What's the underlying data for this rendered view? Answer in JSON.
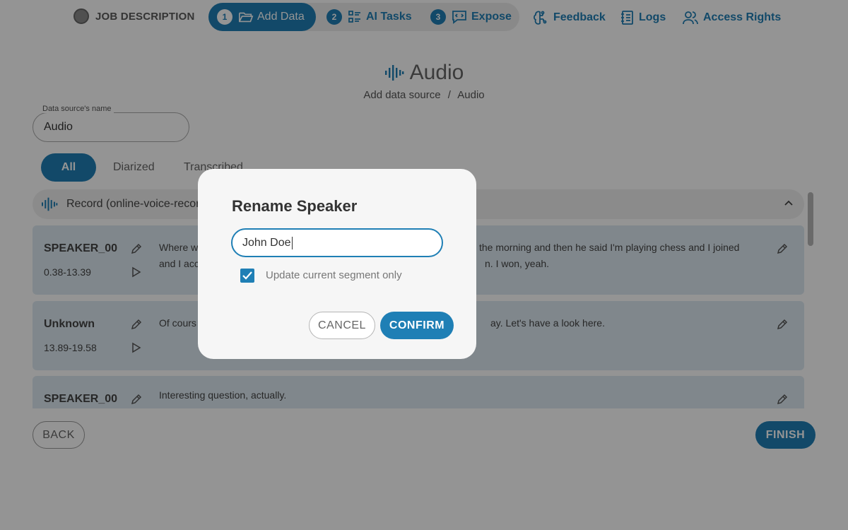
{
  "nav": {
    "job_label": "JOB DESCRIPTION",
    "steps": [
      {
        "num": "1",
        "label": "Add Data",
        "icon": "folder-open-icon"
      },
      {
        "num": "2",
        "label": "AI Tasks",
        "icon": "task-list-icon"
      },
      {
        "num": "3",
        "label": "Expose",
        "icon": "code-bubble-icon"
      }
    ],
    "links": [
      {
        "label": "Feedback",
        "icon": "brain-icon"
      },
      {
        "label": "Logs",
        "icon": "notebook-icon"
      },
      {
        "label": "Access Rights",
        "icon": "users-icon"
      }
    ]
  },
  "header": {
    "title": "Audio",
    "breadcrumb": [
      "Add data source",
      "/",
      "Audio"
    ]
  },
  "source": {
    "label": "Data source's name",
    "value": "Audio"
  },
  "tabs": [
    "All",
    "Diarized",
    "Transcribed"
  ],
  "record": {
    "label": "Record (online-voice-recor"
  },
  "segments": [
    {
      "speaker": "SPEAKER_00",
      "time": "0.38-13.39",
      "text_left": "Where w",
      "text_left2": "and I acc",
      "text_right": "the morning and then he said I'm playing chess and I joined",
      "text_right2": "n. I won, yeah."
    },
    {
      "speaker": "Unknown",
      "time": "13.89-19.58",
      "text_left": "Of cours",
      "text_right": "ay. Let's have a look here."
    },
    {
      "speaker": "SPEAKER_00",
      "text_left": "Interesting question, actually."
    }
  ],
  "footer": {
    "back": "BACK",
    "finish": "FINISH"
  },
  "modal": {
    "title": "Rename Speaker",
    "input_value": "John Doe",
    "checkbox_label": "Update current segment only",
    "checkbox_checked": true,
    "cancel": "CANCEL",
    "confirm": "CONFIRM"
  },
  "colors": {
    "accent": "#1f7fb5",
    "segment_bg": "#dde9f1"
  }
}
